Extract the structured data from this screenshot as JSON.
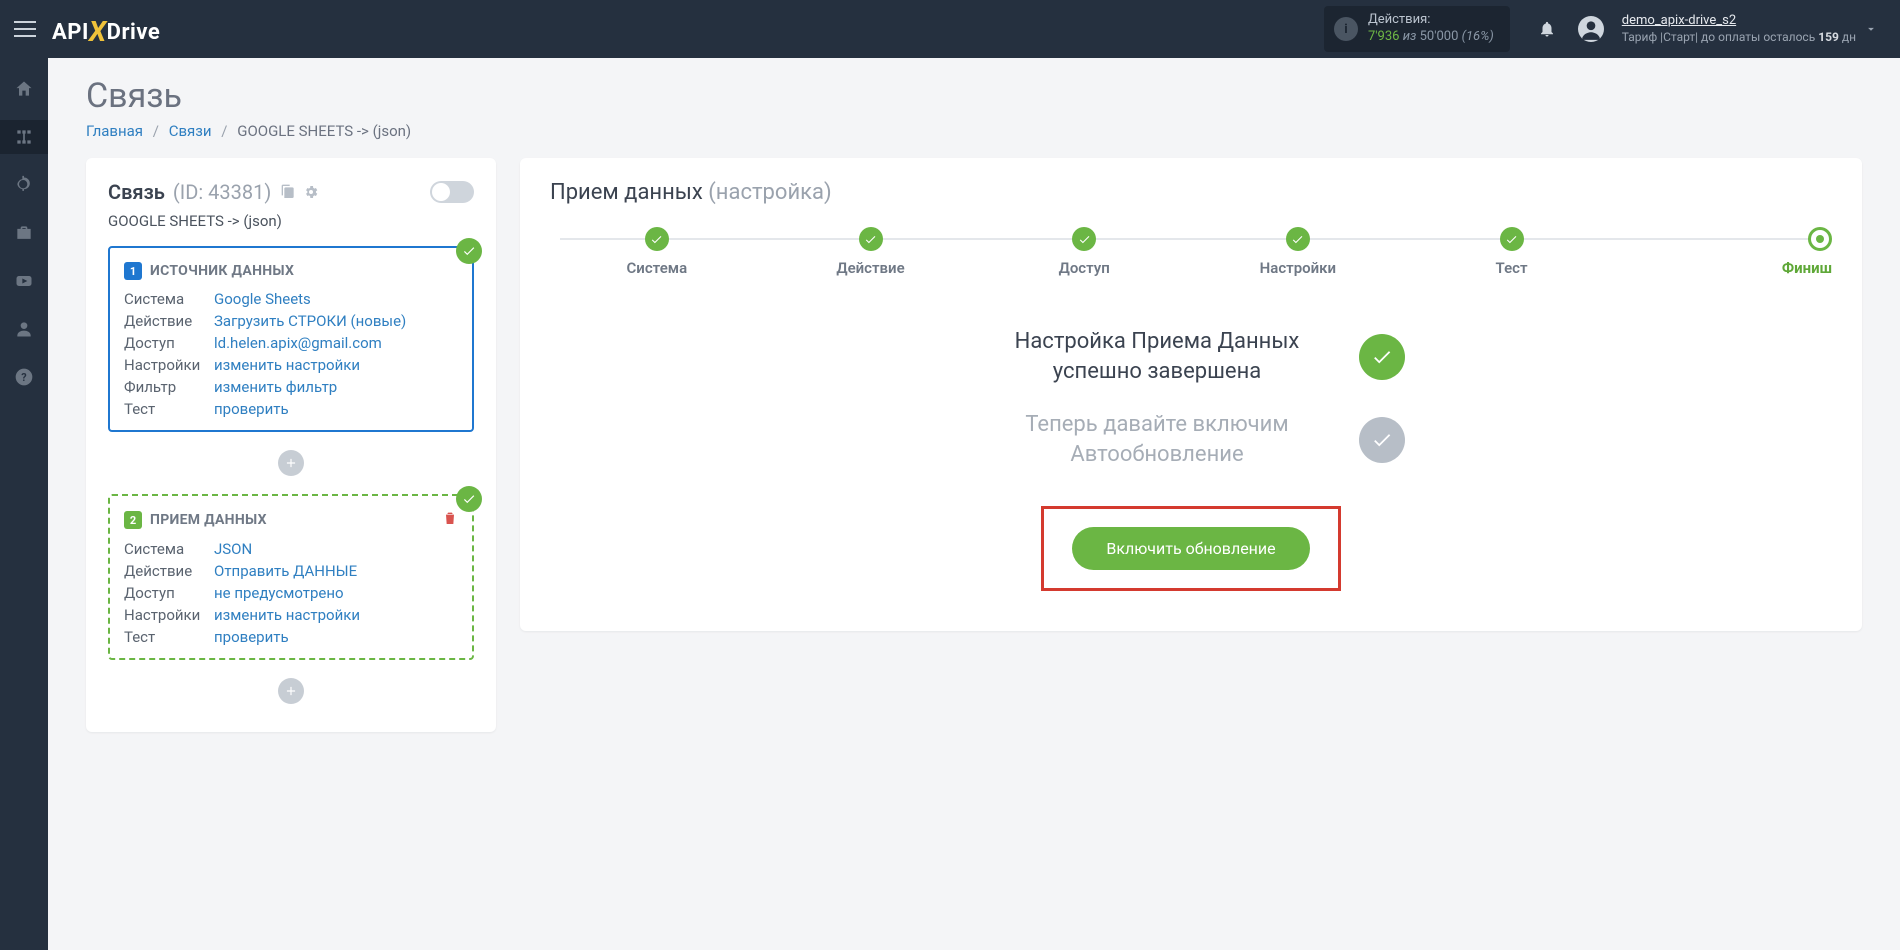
{
  "topbar": {
    "actions_label": "Действия:",
    "used": "7'936",
    "of_word": "из",
    "total": "50'000",
    "percent": "(16%)",
    "username": "demo_apix-drive_s2",
    "tariff_line_prefix": "Тариф |Старт| до оплаты осталось ",
    "tariff_days": "159",
    "tariff_suffix": " дн"
  },
  "page": {
    "title": "Связь",
    "crumb_home": "Главная",
    "crumb_links": "Связи",
    "crumb_current": "GOOGLE SHEETS -> (json)"
  },
  "left": {
    "head_label": "Связь",
    "head_id": "(ID: 43381)",
    "sub": "GOOGLE SHEETS -> (json)",
    "src": {
      "num": "1",
      "title": "ИСТОЧНИК ДАННЫХ",
      "rows": {
        "system_k": "Система",
        "system_v": "Google Sheets",
        "action_k": "Действие",
        "action_v": "Загрузить СТРОКИ (новые)",
        "access_k": "Доступ",
        "access_v": "ld.helen.apix@gmail.com",
        "settings_k": "Настройки",
        "settings_v": "изменить настройки",
        "filter_k": "Фильтр",
        "filter_v": "изменить фильтр",
        "test_k": "Тест",
        "test_v": "проверить"
      }
    },
    "dst": {
      "num": "2",
      "title": "ПРИЕМ ДАННЫХ",
      "rows": {
        "system_k": "Система",
        "system_v": "JSON",
        "action_k": "Действие",
        "action_v": "Отправить ДАННЫЕ",
        "access_k": "Доступ",
        "access_v": "не предусмотрено",
        "settings_k": "Настройки",
        "settings_v": "изменить настройки",
        "test_k": "Тест",
        "test_v": "проверить"
      }
    }
  },
  "right": {
    "head_main": "Прием данных",
    "head_sub": "(настройка)",
    "steps": {
      "s1": "Система",
      "s2": "Действие",
      "s3": "Доступ",
      "s4": "Настройки",
      "s5": "Тест",
      "s6": "Финиш"
    },
    "finish1": "Настройка Приема Данных успешно завершена",
    "finish2": "Теперь давайте включим Автообновление",
    "enable_label": "Включить обновление"
  }
}
